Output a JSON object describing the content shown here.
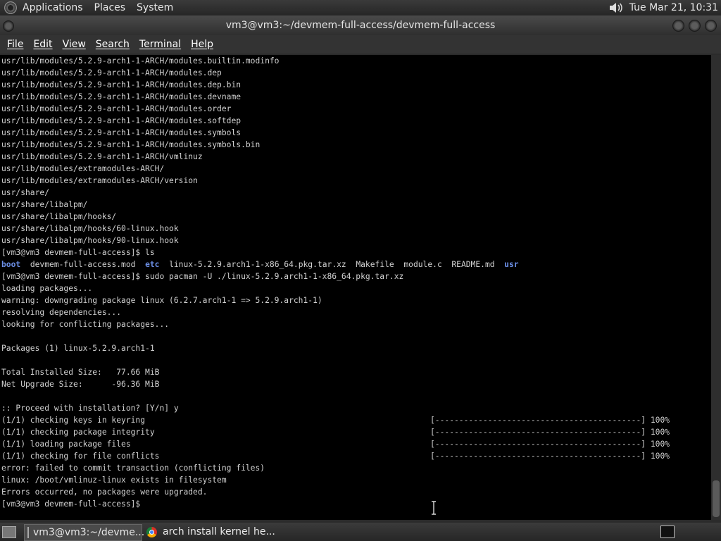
{
  "top_panel": {
    "menus": [
      "Applications",
      "Places",
      "System"
    ],
    "clock": "Tue Mar 21, 10:31"
  },
  "window": {
    "title": "vm3@vm3:~/devmem-full-access/devmem-full-access"
  },
  "menubar": [
    "File",
    "Edit",
    "View",
    "Search",
    "Terminal",
    "Help"
  ],
  "terminal": {
    "lines": [
      "usr/lib/modules/5.2.9-arch1-1-ARCH/modules.builtin.modinfo",
      "usr/lib/modules/5.2.9-arch1-1-ARCH/modules.dep",
      "usr/lib/modules/5.2.9-arch1-1-ARCH/modules.dep.bin",
      "usr/lib/modules/5.2.9-arch1-1-ARCH/modules.devname",
      "usr/lib/modules/5.2.9-arch1-1-ARCH/modules.order",
      "usr/lib/modules/5.2.9-arch1-1-ARCH/modules.softdep",
      "usr/lib/modules/5.2.9-arch1-1-ARCH/modules.symbols",
      "usr/lib/modules/5.2.9-arch1-1-ARCH/modules.symbols.bin",
      "usr/lib/modules/5.2.9-arch1-1-ARCH/vmlinuz",
      "usr/lib/modules/extramodules-ARCH/",
      "usr/lib/modules/extramodules-ARCH/version",
      "usr/share/",
      "usr/share/libalpm/",
      "usr/share/libalpm/hooks/",
      "usr/share/libalpm/hooks/60-linux.hook",
      "usr/share/libalpm/hooks/90-linux.hook",
      "[vm3@vm3 devmem-full-access]$ ls"
    ],
    "ls_output": {
      "dir1": "boot",
      "f1": "  devmem-full-access.mod  ",
      "dir2": "etc",
      "f2": "  linux-5.2.9.arch1-1-x86_64.pkg.tar.xz  Makefile  module.c  README.md  ",
      "dir3": "usr"
    },
    "lines2": [
      "[vm3@vm3 devmem-full-access]$ sudo pacman -U ./linux-5.2.9.arch1-1-x86_64.pkg.tar.xz",
      "loading packages...",
      "warning: downgrading package linux (6.2.7.arch1-1 => 5.2.9.arch1-1)",
      "resolving dependencies...",
      "looking for conflicting packages...",
      "",
      "Packages (1) linux-5.2.9.arch1-1",
      "",
      "Total Installed Size:   77.66 MiB",
      "Net Upgrade Size:      -96.36 MiB",
      "",
      ":: Proceed with installation? [Y/n] y"
    ],
    "progress": [
      {
        "label": "(1/1) checking keys in keyring",
        "bar": "[-------------------------------------------] 100%"
      },
      {
        "label": "(1/1) checking package integrity",
        "bar": "[-------------------------------------------] 100%"
      },
      {
        "label": "(1/1) loading package files",
        "bar": "[-------------------------------------------] 100%"
      },
      {
        "label": "(1/1) checking for file conflicts",
        "bar": "[-------------------------------------------] 100%"
      }
    ],
    "lines3": [
      "error: failed to commit transaction (conflicting files)",
      "linux: /boot/vmlinuz-linux exists in filesystem",
      "Errors occurred, no packages were upgraded.",
      "[vm3@vm3 devmem-full-access]$"
    ]
  },
  "taskbar": {
    "tasks": [
      "vm3@vm3:~/devme...",
      "arch install kernel he..."
    ]
  }
}
